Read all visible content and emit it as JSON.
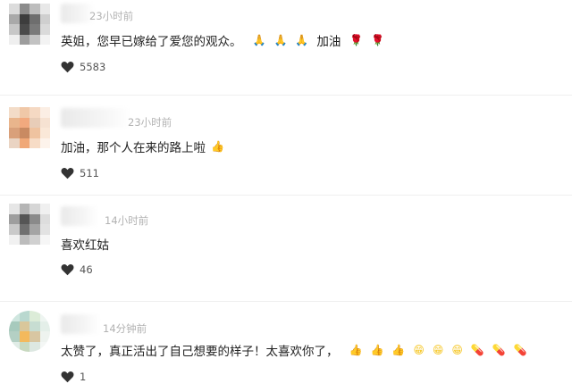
{
  "comments": [
    {
      "time": "23小时前",
      "text": "英姐，您早已嫁给了爱您的观众。",
      "emoji_before": [
        "🙏",
        "🙏",
        "🙏"
      ],
      "inline_text": "加油",
      "emoji_after": [
        "🌹",
        "🌹"
      ],
      "likes": "5583"
    },
    {
      "time": "23小时前",
      "text": "加油，那个人在来的路上啦",
      "emoji_after": [
        "👍"
      ],
      "likes": "511"
    },
    {
      "time": "14小时前",
      "text": "喜欢红姑",
      "likes": "46"
    },
    {
      "time": "14分钟前",
      "text": "太赞了，真正活出了自己想要的样子！太喜欢你了，",
      "emoji_after": [
        "👍",
        "👍",
        "👍",
        "😁",
        "😁",
        "😁",
        "💊",
        "💊",
        "💊"
      ],
      "likes": "1"
    }
  ],
  "icons": {
    "like": "heart-icon",
    "hand": "praying-hands-emoji",
    "rose": "rose-emoji",
    "thumb": "thumbs-up-emoji",
    "smile": "grinning-face-emoji",
    "pill": "pill-emoji"
  },
  "colors": {
    "text": "#222222",
    "time": "#b2b2b2",
    "like_count": "#555555",
    "heart": "#333333"
  }
}
